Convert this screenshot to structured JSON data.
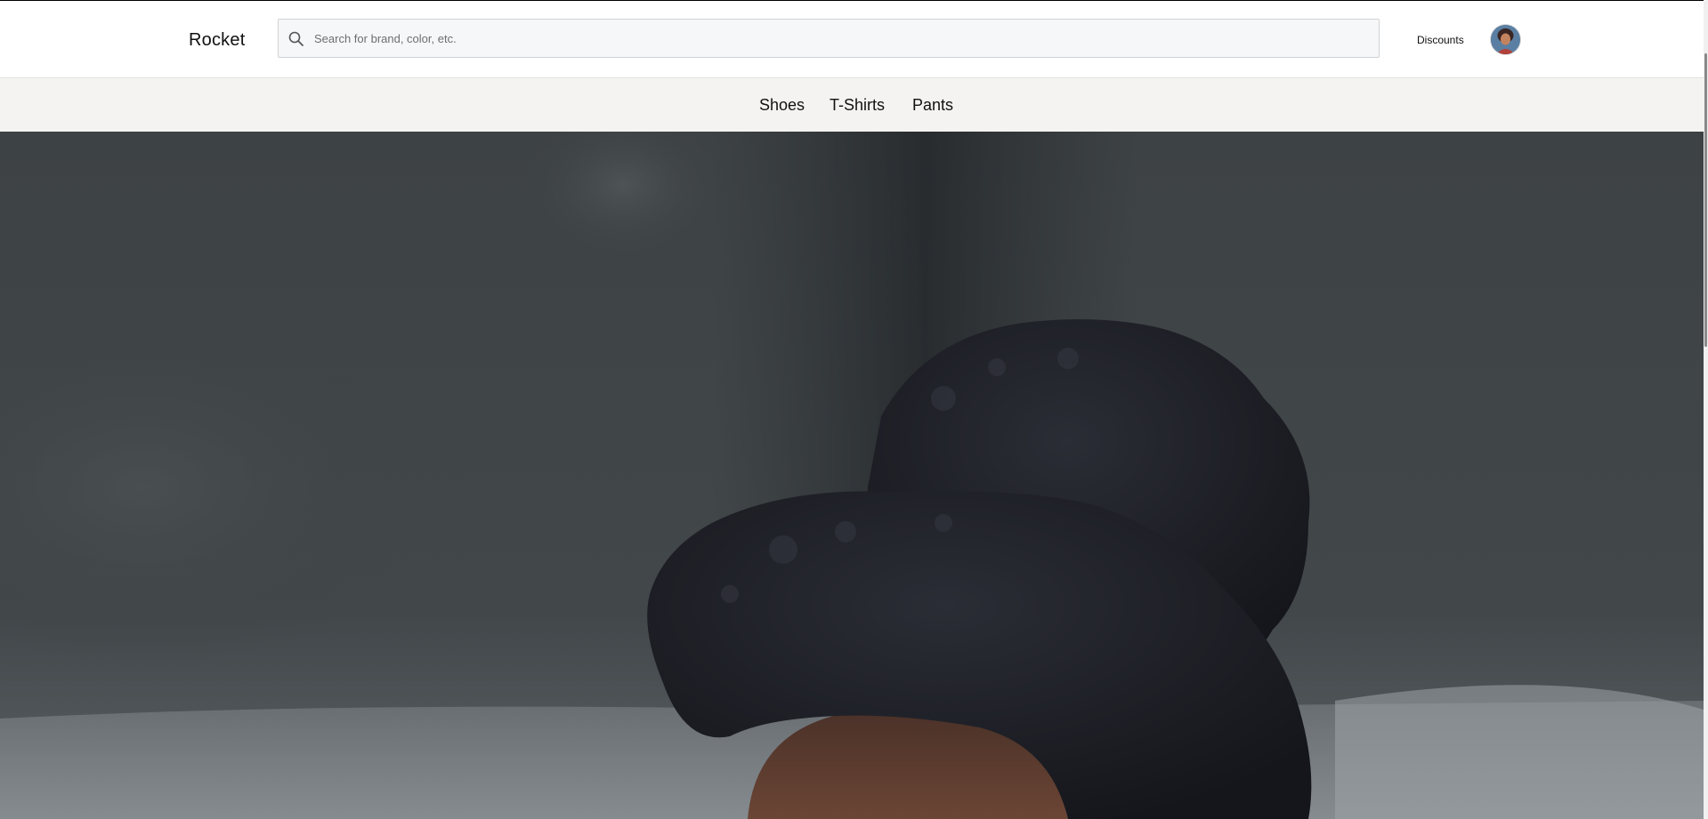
{
  "header": {
    "logo": "Rocket",
    "search": {
      "placeholder": "Search for brand, color, etc.",
      "value": "",
      "icon": "search-icon"
    },
    "discounts_label": "Discounts",
    "avatar_icon": "user-avatar"
  },
  "categories": [
    {
      "label": "Shoes"
    },
    {
      "label": "T-Shirts"
    },
    {
      "label": "Pants"
    }
  ],
  "hero": {
    "image": "hero-video-frame"
  },
  "colors": {
    "category_bar": "#f4f3f1",
    "hero_background": "#3a3f42",
    "hair": "#1e2027"
  }
}
